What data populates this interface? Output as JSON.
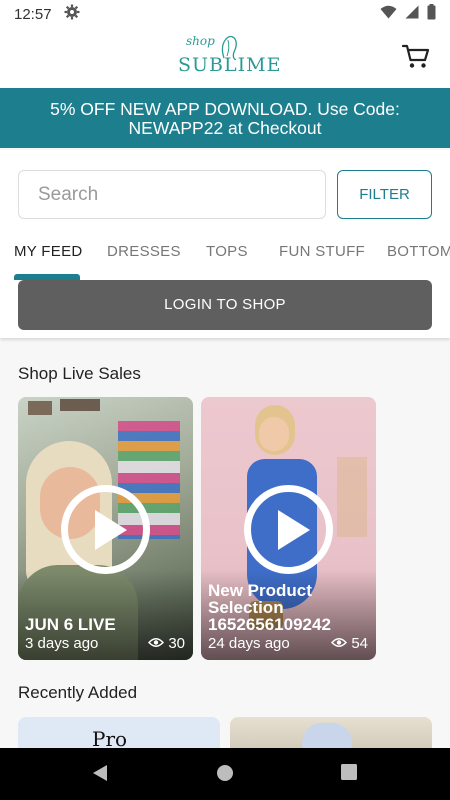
{
  "status": {
    "time": "12:57"
  },
  "header": {
    "logo_script": "shop",
    "logo_text": "SUBLIME"
  },
  "promo": {
    "line1": "5% OFF NEW APP DOWNLOAD.  Use Code:",
    "line2": "NEWAPP22 at Checkout"
  },
  "search": {
    "placeholder": "Search",
    "filter_label": "FILTER"
  },
  "tabs": [
    {
      "label": "MY FEED",
      "active": true
    },
    {
      "label": "DRESSES",
      "active": false
    },
    {
      "label": "TOPS",
      "active": false
    },
    {
      "label": "FUN STUFF",
      "active": false
    },
    {
      "label": "BOTTOMS",
      "active": false
    }
  ],
  "login": {
    "label": "LOGIN TO SHOP"
  },
  "live_sales": {
    "title": "Shop Live Sales",
    "cards": [
      {
        "title": "JUN 6 LIVE",
        "ago": "3 days ago",
        "views": "30"
      },
      {
        "title_line1": "New Product",
        "title_line2": "Selection",
        "title_line3": "1652656109242",
        "ago": "24 days ago",
        "views": "54"
      }
    ]
  },
  "recently_added": {
    "title": "Recently Added",
    "card1_logo": "Pro"
  },
  "colors": {
    "brand": "#1d7f8e",
    "logo": "#2b9a94",
    "login_button": "#5f5f5f"
  }
}
